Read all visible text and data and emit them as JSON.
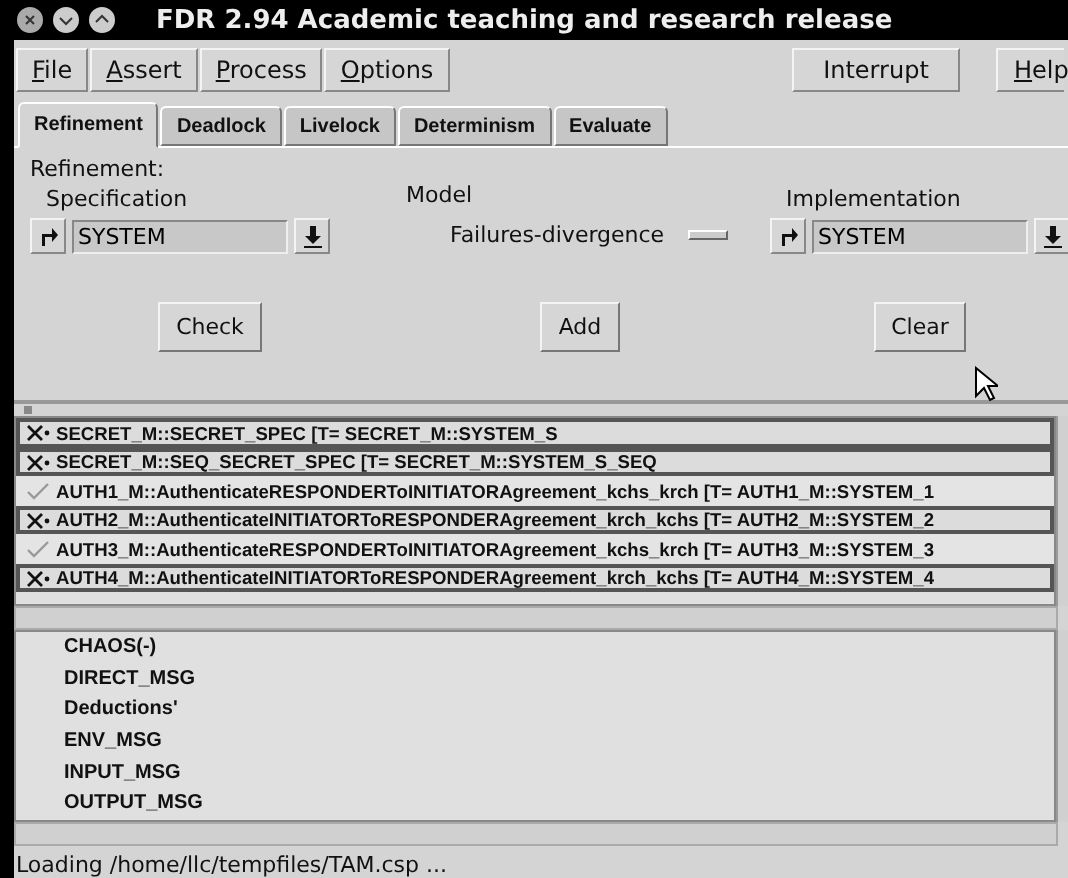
{
  "window": {
    "title": "FDR 2.94 Academic teaching and research release"
  },
  "menu": [
    {
      "label": "File"
    },
    {
      "label": "Assert"
    },
    {
      "label": "Process"
    },
    {
      "label": "Options"
    }
  ],
  "interrupt_button": "Interrupt",
  "help": {
    "label": "Help"
  },
  "tabs": [
    {
      "label": "Refinement",
      "selected": true
    },
    {
      "label": "Deadlock",
      "selected": false
    },
    {
      "label": "Livelock",
      "selected": false
    },
    {
      "label": "Determinism",
      "selected": false
    },
    {
      "label": "Evaluate",
      "selected": false
    }
  ],
  "refinement": {
    "heading": "Refinement:",
    "specification": {
      "label": "Specification",
      "value": "SYSTEM"
    },
    "model": {
      "label": "Model",
      "value": "Failures-divergence"
    },
    "implementation": {
      "label": "Implementation",
      "value": "SYSTEM"
    }
  },
  "buttons": [
    "Check",
    "Add",
    "Clear"
  ],
  "assertions": [
    {
      "failed": true,
      "text": "SECRET_M::SECRET_SPEC [T= SECRET_M::SYSTEM_S"
    },
    {
      "failed": true,
      "text": "SECRET_M::SEQ_SECRET_SPEC [T= SECRET_M::SYSTEM_S_SEQ"
    },
    {
      "failed": false,
      "text": "AUTH1_M::AuthenticateRESPONDERToINITIATORAgreement_kchs_krch [T= AUTH1_M::SYSTEM_1"
    },
    {
      "failed": true,
      "text": "AUTH2_M::AuthenticateINITIATORToRESPONDERAgreement_krch_kchs [T= AUTH2_M::SYSTEM_2"
    },
    {
      "failed": false,
      "text": "AUTH3_M::AuthenticateRESPONDERToINITIATORAgreement_kchs_krch [T= AUTH3_M::SYSTEM_3"
    },
    {
      "failed": true,
      "text": "AUTH4_M::AuthenticateINITIATORToRESPONDERAgreement_krch_kchs [T= AUTH4_M::SYSTEM_4"
    }
  ],
  "processes": [
    "CHAOS(-)",
    "DIRECT_MSG",
    "Deductions'",
    "ENV_MSG",
    "INPUT_MSG",
    "OUTPUT_MSG"
  ],
  "status_bar": "Loading /home/llc/tempfiles/TAM.csp ..."
}
